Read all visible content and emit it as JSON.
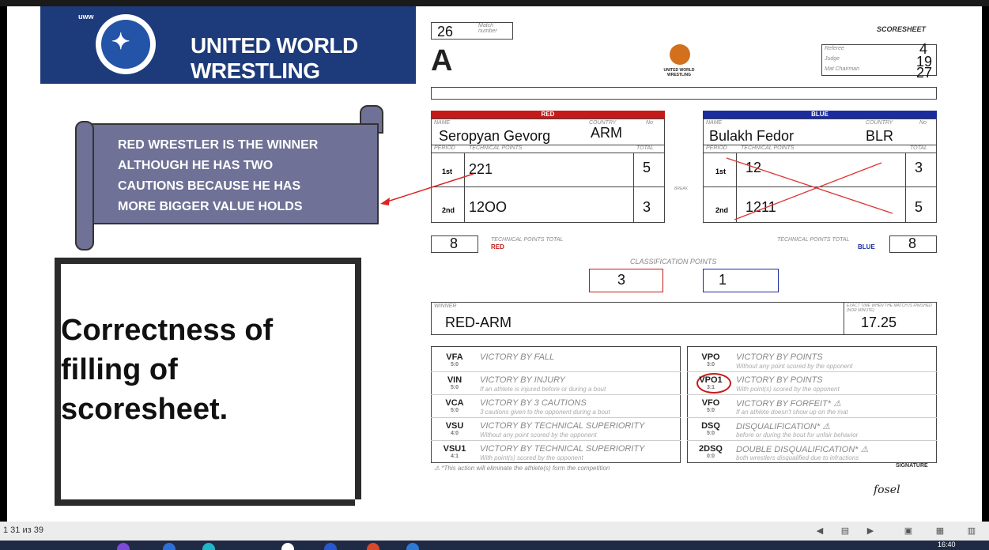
{
  "top_strip": "",
  "banner": {
    "title": "UNITED WORLD WRESTLING",
    "tag": "uww"
  },
  "callout": {
    "lines": [
      "RED WRESTLER  IS  THE WINNER",
      "ALTHOUGH HE HAS TWO",
      "CAUTIONS BECAUSE HE HAS",
      "MORE BIGGER VALUE HOLDS"
    ]
  },
  "slide_title": {
    "lines": [
      "Correctness of",
      "filling of",
      "scoresheet."
    ]
  },
  "scoresheet": {
    "match_number": "26",
    "match_number_label": "Match number",
    "mat": "A",
    "heading": "SCORESHEET",
    "logo_text": "UNITED WORLD WRESTLING",
    "officials": [
      {
        "label": "Referee",
        "value": "4"
      },
      {
        "label": "Judge",
        "value": "19"
      },
      {
        "label": "Mat Chairman",
        "value": "27"
      }
    ],
    "red": {
      "header": "RED",
      "name_label": "NAME",
      "country_label": "COUNTRY",
      "no_label": "No",
      "name": "Seropyan Gevorg",
      "country": "ARM",
      "period_label": "PERIOD",
      "tp_label": "TECHNICAL POINTS",
      "total_label": "TOTAL",
      "p1_label": "1st",
      "p1_points": "221",
      "p1_total": "5",
      "p2_label": "2nd",
      "p2_points": "12OO",
      "p2_total": "3",
      "tp_total": "8",
      "tp_total_label": "TECHNICAL POINTS TOTAL",
      "tp_total_color_label": "RED"
    },
    "blue": {
      "header": "BLUE",
      "name_label": "NAME",
      "country_label": "COUNTRY",
      "no_label": "No",
      "name": "Bulakh Fedor",
      "country": "BLR",
      "period_label": "PERIOD",
      "tp_label": "TECHNICAL POINTS",
      "total_label": "TOTAL",
      "p1_label": "1st",
      "p1_points": "12",
      "p1_total": "3",
      "p2_label": "2nd",
      "p2_points": "1211",
      "p2_total": "5",
      "tp_total": "8",
      "tp_total_label": "TECHNICAL POINTS TOTAL",
      "tp_total_color_label": "BLUE"
    },
    "break_label": "BREAK",
    "classification_label": "CLASSIFICATION POINTS",
    "classification_red": "3",
    "classification_blue": "1",
    "winner_label": "WINNER",
    "winner": "RED-ARM",
    "time_label": "EXACT TIME WHEN THE MATCH IS FINISHED (Nor minute)",
    "time": "17.25",
    "victories_left": [
      {
        "code": "VFA",
        "pts": "5:0",
        "name": "VICTORY BY FALL",
        "desc": ""
      },
      {
        "code": "VIN",
        "pts": "5:0",
        "name": "VICTORY BY INJURY",
        "desc": "If an athlete is injured before or during a bout"
      },
      {
        "code": "VCA",
        "pts": "5:0",
        "name": "VICTORY BY 3 CAUTIONS",
        "desc": "3 cautions given to the opponent during a bout"
      },
      {
        "code": "VSU",
        "pts": "4:0",
        "name": "VICTORY BY TECHNICAL SUPERIORITY",
        "desc": "Without any point scored by the opponent"
      },
      {
        "code": "VSU1",
        "pts": "4:1",
        "name": "VICTORY BY TECHNICAL SUPERIORITY",
        "desc": "With point(s) scored by the opponent"
      }
    ],
    "victories_right": [
      {
        "code": "VPO",
        "pts": "3:0",
        "name": "VICTORY BY POINTS",
        "desc": "Without any point scored by the opponent"
      },
      {
        "code": "VPO1",
        "pts": "3:1",
        "name": "VICTORY BY POINTS",
        "desc": "With point(s) scored by the opponent"
      },
      {
        "code": "VFO",
        "pts": "5:0",
        "name": "VICTORY BY FORFEIT* ⚠",
        "desc": "If an athlete doesn't show up on the mat"
      },
      {
        "code": "DSQ",
        "pts": "5:0",
        "name": "DISQUALIFICATION* ⚠",
        "desc": "before or during the bout for unfair behavior"
      },
      {
        "code": "2DSQ",
        "pts": "0:0",
        "name": "DOUBLE DISQUALIFICATION* ⚠",
        "desc": "both wrestlers disqualified due to infractions"
      }
    ],
    "footnote": "⚠  *This action will eliminate the athlete(s) form the competition",
    "signature_label": "SIGNATURE",
    "signature": "fosel"
  },
  "status": {
    "page": "1 31 из 39",
    "clock": "16:40"
  }
}
